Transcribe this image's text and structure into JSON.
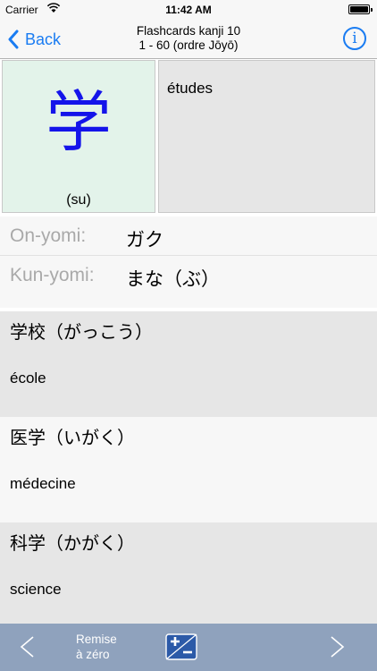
{
  "status_bar": {
    "carrier": "Carrier",
    "time": "11:42 AM"
  },
  "nav": {
    "back_label": "Back",
    "title_line1": "Flashcards kanji 10",
    "title_line2": "1 - 60 (ordre Jōyō)",
    "info_label": "i",
    "accent_color": "#1a7cf2"
  },
  "card": {
    "kanji": "学",
    "reading": "(su)",
    "meaning": "études",
    "kanji_color": "#1414ea"
  },
  "readings": {
    "onyomi_label": "On-yomi:",
    "onyomi_value": "ガク",
    "kunyomi_label": "Kun-yomi:",
    "kunyomi_value": "まな（ぶ）"
  },
  "vocabulary": [
    {
      "word": "学校（がっこう）",
      "meaning": "école"
    },
    {
      "word": "医学（いがく）",
      "meaning": "médecine"
    },
    {
      "word": "科学（かがく）",
      "meaning": "science"
    }
  ],
  "toolbar": {
    "reset_line1": "Remise",
    "reset_line2": "à zéro",
    "prev_icon": "left-arrow-icon",
    "next_icon": "right-arrow-icon",
    "plusminus_icon": "plus-minus-icon"
  }
}
